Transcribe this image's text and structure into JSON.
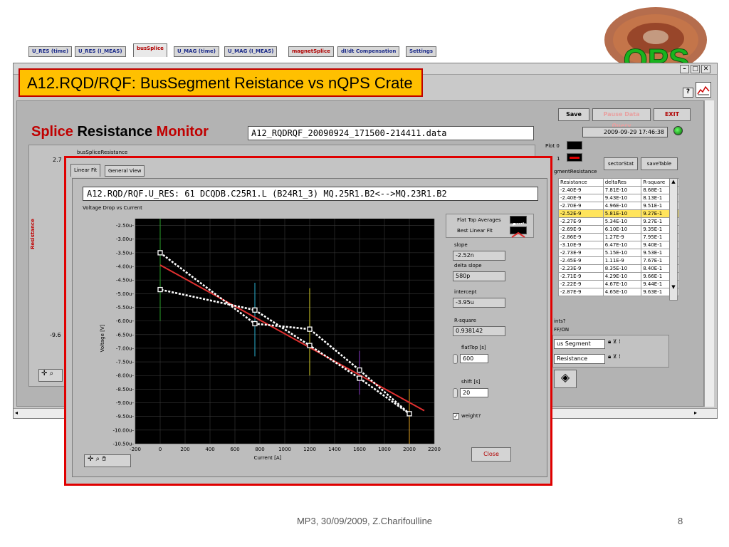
{
  "slide_title": "A12.RQD/RQF: BusSegment Reistance vs nQPS Crate",
  "window": {
    "tabs": [
      "U_RES (time)",
      "U_RES (I_MEAS)",
      "busSplice",
      "U_MAG (time)",
      "U_MAG (I_MEAS)",
      "magnetSplice",
      "dI/dt Compensation",
      "Settings"
    ],
    "save_label": "Save",
    "pause_label": "Pause Data Query",
    "exit_label": "EXIT",
    "monitor_title": {
      "a": "Splice",
      "b": " Resistance ",
      "c": "Monitor"
    },
    "filename": "A12_RQDRQF_20090924_171500-214411.data",
    "datetime": "2009-09-29 17:46:38",
    "bg_label": "busSpliceResistance",
    "bg_yaxis": "Resistance",
    "bg_tick_top": "2.7",
    "bg_tick_bottom": "-9.6",
    "plot0": "Plot 0",
    "plot1": "1",
    "sector_stat": "sectorStat",
    "save_table": "saveTable",
    "segment_resistance": "gmentResistance",
    "points_label": "ints?",
    "points_value": "FF/ON",
    "bus_segment": "us Segment",
    "resistance_sel": "Resistance",
    "bg_table": {
      "headers": [
        "Resistance",
        "deltaRes",
        "R-square"
      ],
      "rows": [
        [
          "-2.40E-9",
          "7.81E-10",
          "8.68E-1"
        ],
        [
          "-2.40E-9",
          "9.43E-10",
          "8.13E-1"
        ],
        [
          "-2.70E-9",
          "4.96E-10",
          "9.51E-1"
        ],
        [
          "-2.52E-9",
          "5.81E-10",
          "9.27E-1"
        ],
        [
          "-2.27E-9",
          "5.34E-10",
          "9.27E-1"
        ],
        [
          "-2.69E-9",
          "6.10E-10",
          "9.35E-1"
        ],
        [
          "-2.86E-9",
          "1.27E-9",
          "7.95E-1"
        ],
        [
          "-3.10E-9",
          "6.47E-10",
          "9.40E-1"
        ],
        [
          "-2.73E-9",
          "5.15E-10",
          "9.53E-1"
        ],
        [
          "-2.45E-9",
          "1.11E-9",
          "7.67E-1"
        ],
        [
          "-2.23E-9",
          "8.35E-10",
          "8.40E-1"
        ],
        [
          "-2.71E-9",
          "4.29E-10",
          "9.66E-1"
        ],
        [
          "-2.22E-9",
          "4.67E-10",
          "9.44E-1"
        ],
        [
          "-2.87E-9",
          "4.65E-10",
          "9.63E-1"
        ]
      ],
      "highlight_row": 3
    }
  },
  "dialog": {
    "tabs": [
      "Linear Fit",
      "General View"
    ],
    "signal": "A12.RQD/RQF.U_RES: 61 DCQDB.C25R1.L (B24R1_3) MQ.25R1.B2<-->MQ.23R1.B2",
    "plot_label": "Voltage Drop vs Current",
    "legend": [
      "Flat Top Averages",
      "Best Linear Fit"
    ],
    "slope_label": "slope",
    "slope_value": "-2.52n",
    "delta_slope_label": "delta slope",
    "delta_slope_value": "580p",
    "intercept_label": "intercept",
    "intercept_value": "-3.95u",
    "rsquare_label": "R-square",
    "rsquare_value": "0.938142",
    "flattop_label": "flatTop [s]",
    "flattop_value": "600",
    "shift_label": "shift [s]",
    "shift_value": "20",
    "weight_label": "weight?",
    "close_label": "Close"
  },
  "chart_data": {
    "type": "scatter",
    "title": "Voltage Drop vs Current",
    "xlabel": "Current [A]",
    "ylabel": "Voltage [V]",
    "xlim": [
      -200,
      2200
    ],
    "ylim": [
      -10.5,
      -2.25
    ],
    "x_ticks": [
      "-200",
      "0",
      "200",
      "400",
      "600",
      "800",
      "1000",
      "1200",
      "1400",
      "1600",
      "1800",
      "2000",
      "2200"
    ],
    "y_ticks": [
      "-2.50u-",
      "-3.00u-",
      "-3.50u-",
      "-4.00u-",
      "-4.50u-",
      "-5.00u-",
      "-5.50u-",
      "-6.00u-",
      "-6.50u-",
      "-7.00u-",
      "-7.50u-",
      "-8.00u-",
      "-8.50u-",
      "-9.00u-",
      "-9.50u-",
      "-10.00u-",
      "-10.50u-"
    ],
    "series": [
      {
        "name": "Flat Top Averages",
        "points": [
          [
            0,
            -3.5
          ],
          [
            760,
            -6.1
          ],
          [
            1200,
            -6.3
          ],
          [
            1600,
            -7.8
          ],
          [
            2000,
            -9.4
          ],
          [
            1600,
            -8.1
          ],
          [
            1200,
            -6.9
          ],
          [
            760,
            -5.6
          ],
          [
            0,
            -4.85
          ]
        ]
      },
      {
        "name": "Best Linear Fit",
        "line": [
          [
            0,
            -3.95
          ],
          [
            2120,
            -9.29
          ]
        ]
      }
    ],
    "error_bars": [
      {
        "x": 0,
        "ymin": -2.25,
        "ymax": -6.0,
        "color": "#2aa02a"
      },
      {
        "x": 760,
        "ymin": -4.6,
        "ymax": -7.3,
        "color": "#2ab0d0"
      },
      {
        "x": 1200,
        "ymin": -4.8,
        "ymax": -8.0,
        "color": "#d7d22a"
      },
      {
        "x": 1600,
        "ymin": -7.1,
        "ymax": -8.7,
        "color": "#8a3ac8"
      },
      {
        "x": 2000,
        "ymin": -8.5,
        "ymax": -10.5,
        "color": "#e0a020"
      }
    ]
  },
  "footer": "MP3, 30/09/2009, Z.Charifoulline",
  "page_number": "8"
}
